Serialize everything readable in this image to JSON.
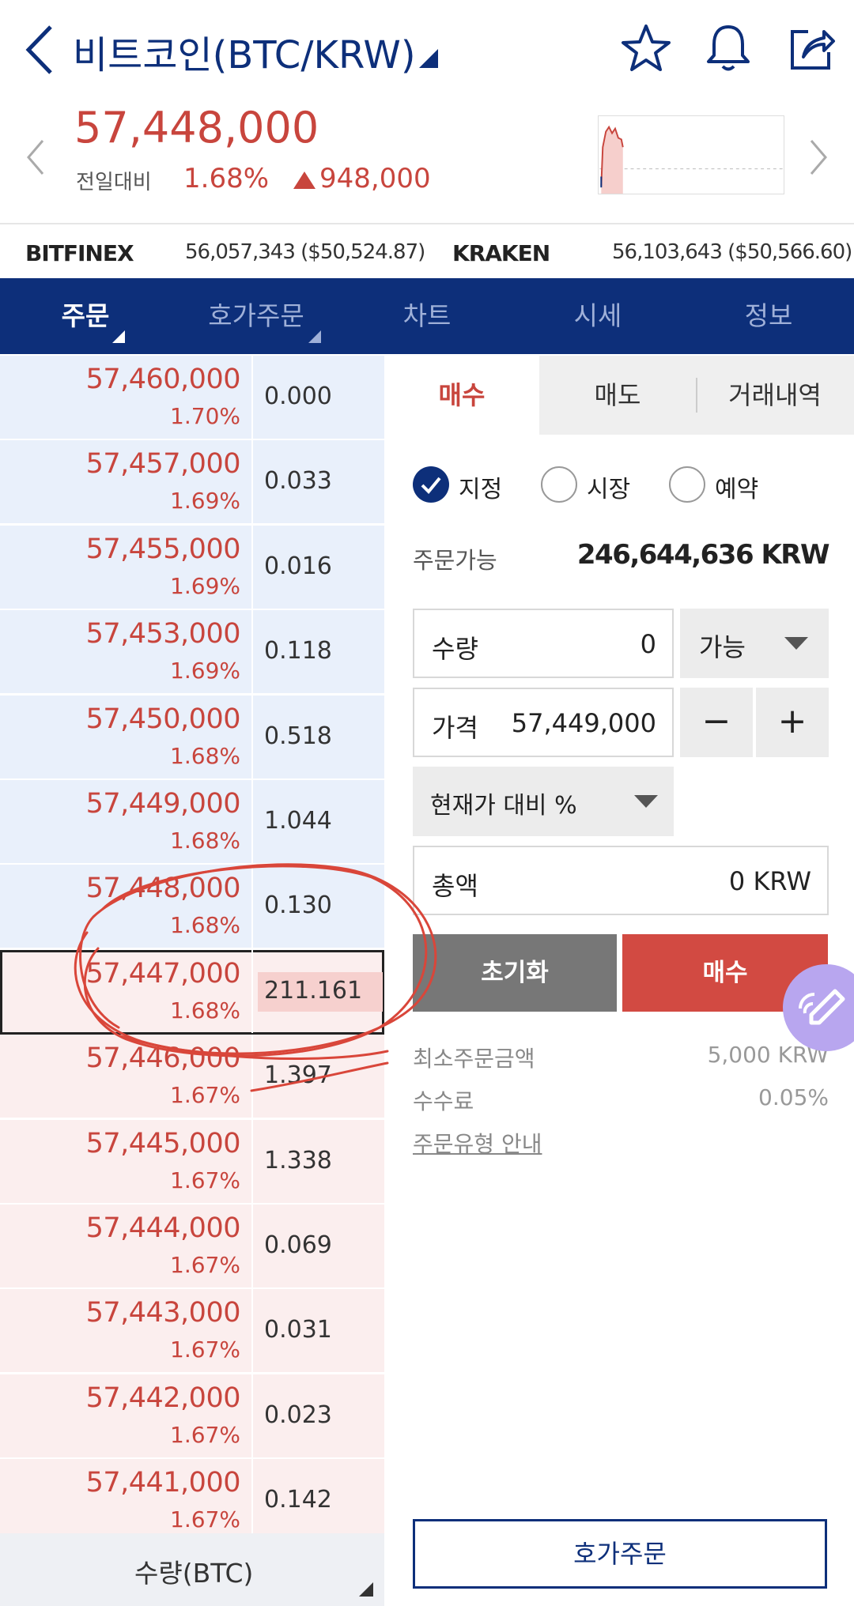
{
  "header": {
    "title": "비트코인(BTC/KRW)",
    "icons": [
      "back-icon",
      "dropdown-caret-icon",
      "star-icon",
      "bell-icon",
      "share-icon"
    ]
  },
  "ticker": {
    "price": "57,448,000",
    "prev_label": "전일대비",
    "change_pct": "1.68%",
    "change_amount": "948,000",
    "change_direction": "up",
    "up_color": "#c8453d"
  },
  "exchanges": [
    {
      "name": "BITFINEX",
      "value": "56,057,343 ($50,524.87)"
    },
    {
      "name": "KRAKEN",
      "value": "56,103,643 ($50,566.60)"
    }
  ],
  "tabs": [
    {
      "label": "주문",
      "active": true
    },
    {
      "label": "호가주문",
      "active": false
    },
    {
      "label": "차트",
      "active": false
    },
    {
      "label": "시세",
      "active": false
    },
    {
      "label": "정보",
      "active": false
    }
  ],
  "orderbook": {
    "rows": [
      {
        "price": "57,460,000",
        "pct": "1.70%",
        "qty": "0.000",
        "side": "ask"
      },
      {
        "price": "57,457,000",
        "pct": "1.69%",
        "qty": "0.033",
        "side": "ask"
      },
      {
        "price": "57,455,000",
        "pct": "1.69%",
        "qty": "0.016",
        "side": "ask"
      },
      {
        "price": "57,453,000",
        "pct": "1.69%",
        "qty": "0.118",
        "side": "ask"
      },
      {
        "price": "57,450,000",
        "pct": "1.68%",
        "qty": "0.518",
        "side": "ask"
      },
      {
        "price": "57,449,000",
        "pct": "1.68%",
        "qty": "1.044",
        "side": "ask"
      },
      {
        "price": "57,448,000",
        "pct": "1.68%",
        "qty": "0.130",
        "side": "ask"
      },
      {
        "price": "57,447,000",
        "pct": "1.68%",
        "qty": "211.161",
        "side": "bid",
        "current": true
      },
      {
        "price": "57,446,000",
        "pct": "1.67%",
        "qty": "1.397",
        "side": "bid"
      },
      {
        "price": "57,445,000",
        "pct": "1.67%",
        "qty": "1.338",
        "side": "bid"
      },
      {
        "price": "57,444,000",
        "pct": "1.67%",
        "qty": "0.069",
        "side": "bid"
      },
      {
        "price": "57,443,000",
        "pct": "1.67%",
        "qty": "0.031",
        "side": "bid"
      },
      {
        "price": "57,442,000",
        "pct": "1.67%",
        "qty": "0.023",
        "side": "bid"
      },
      {
        "price": "57,441,000",
        "pct": "1.67%",
        "qty": "0.142",
        "side": "bid"
      }
    ],
    "footer_label": "수량(BTC)"
  },
  "order_panel": {
    "side_tabs": [
      "매수",
      "매도",
      "거래내역"
    ],
    "active_side_tab": "매수",
    "order_types": [
      {
        "label": "지정",
        "checked": true
      },
      {
        "label": "시장",
        "checked": false
      },
      {
        "label": "예약",
        "checked": false
      }
    ],
    "available_label": "주문가능",
    "available_value": "246,644,636 KRW",
    "quantity_label": "수량",
    "quantity_value": "0",
    "quantity_mode": "가능",
    "price_label": "가격",
    "price_value": "57,449,000",
    "minus": "−",
    "plus": "+",
    "ratio_select": "현재가 대비 %",
    "total_label": "총액",
    "total_value": "0 KRW",
    "reset_button": "초기화",
    "buy_button": "매수",
    "min_order_label": "최소주문금액",
    "min_order_value": "5,000 KRW",
    "fee_label": "수수료",
    "fee_value": "0.05%",
    "guide_link": "주문유형 안내",
    "hoga_button": "호가주문"
  },
  "colors": {
    "brand_navy": "#0d2f7a",
    "ask_bg": "#e9f0fb",
    "bid_bg": "#fbeeee",
    "buy_red": "#d24a42",
    "annotation_red": "#d9463a"
  }
}
